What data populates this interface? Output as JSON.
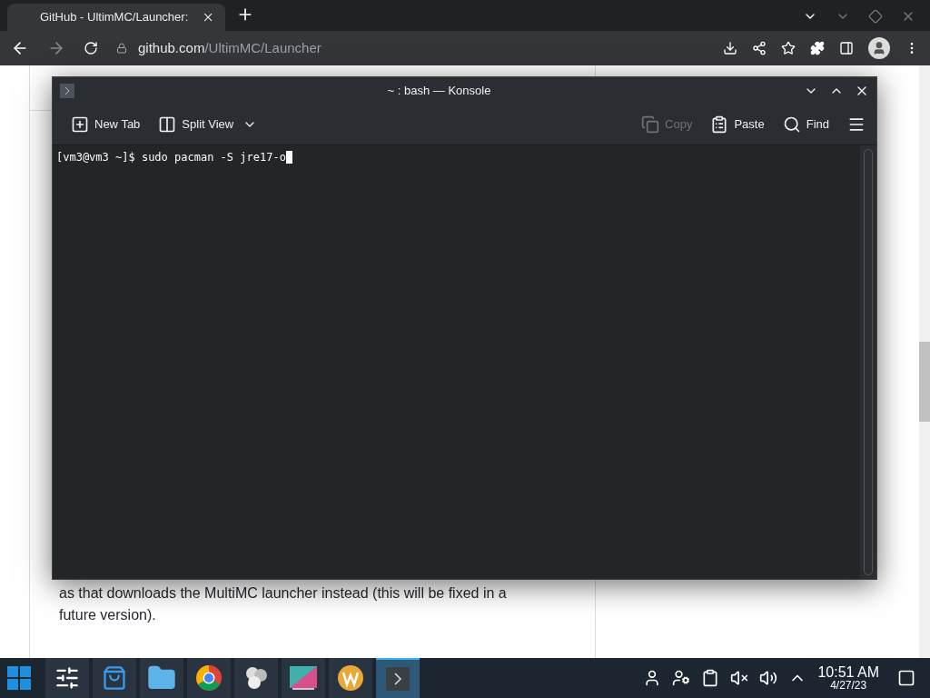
{
  "browser": {
    "tabs": [
      {
        "title": "GitHub - UltimMC/Launcher:",
        "selected": true
      }
    ],
    "url_host": "github.com",
    "url_path": "/UltimMC/Launcher"
  },
  "article": {
    "paragraph": "as that downloads the MultiMC launcher instead (this will be fixed in a future version)."
  },
  "konsole": {
    "title": "~ : bash — Konsole",
    "toolbar_left": [
      {
        "kind": "new-tab",
        "label": "New Tab",
        "disabled": false
      },
      {
        "kind": "split-view",
        "label": "Split View",
        "disabled": false
      }
    ],
    "toolbar_right": [
      {
        "kind": "copy",
        "label": "Copy",
        "disabled": true
      },
      {
        "kind": "paste",
        "label": "Paste",
        "disabled": false
      },
      {
        "kind": "find",
        "label": "Find",
        "disabled": false
      }
    ],
    "prompt": "[vm3@vm3 ~]$ sudo pacman -S jre17-o"
  },
  "taskbar": {
    "apps": [
      {
        "kind": "settings",
        "selected": false
      },
      {
        "kind": "store",
        "selected": false
      },
      {
        "kind": "files",
        "selected": false
      },
      {
        "kind": "browser",
        "selected": false
      },
      {
        "kind": "circles",
        "selected": false
      },
      {
        "kind": "editor",
        "selected": false
      },
      {
        "kind": "w",
        "selected": false
      },
      {
        "kind": "terminal",
        "selected": true
      }
    ],
    "time": "10:51 AM",
    "date": "4/27/23"
  }
}
